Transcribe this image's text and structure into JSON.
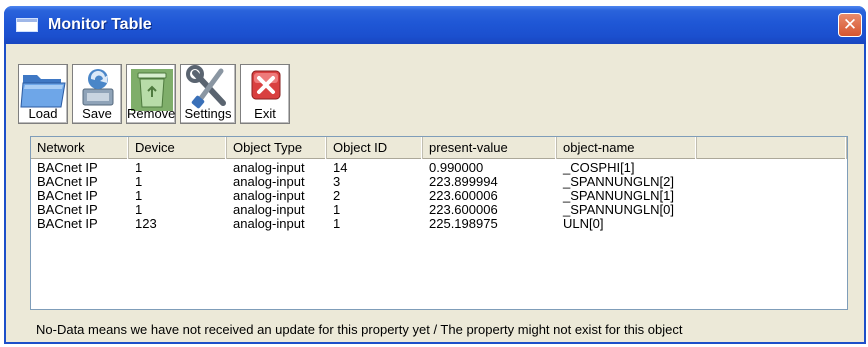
{
  "window": {
    "title": "Monitor Table",
    "close_glyph": "✕"
  },
  "toolbar": {
    "buttons": [
      {
        "label": "Load",
        "icon": "folder-icon"
      },
      {
        "label": "Save",
        "icon": "save-icon"
      },
      {
        "label": "Remove",
        "icon": "trash-icon"
      },
      {
        "label": "Settings",
        "icon": "tools-icon"
      },
      {
        "label": "Exit",
        "icon": "exit-icon"
      }
    ]
  },
  "table": {
    "columns": [
      "Network",
      "Device",
      "Object Type",
      "Object ID",
      "present-value",
      "object-name",
      ""
    ],
    "rows": [
      [
        "BACnet IP",
        "1",
        "analog-input",
        "14",
        "0.990000",
        "_COSPHI[1]"
      ],
      [
        "BACnet IP",
        "1",
        "analog-input",
        "3",
        "223.899994",
        "_SPANNUNGLN[2]"
      ],
      [
        "BACnet IP",
        "1",
        "analog-input",
        "2",
        "223.600006",
        "_SPANNUNGLN[1]"
      ],
      [
        "BACnet IP",
        "1",
        "analog-input",
        "1",
        "223.600006",
        "_SPANNUNGLN[0]"
      ],
      [
        "BACnet IP",
        "123",
        "analog-input",
        "1",
        "225.198975",
        "ULN[0]"
      ]
    ]
  },
  "status": {
    "text": "No-Data means we have not received an update for this property yet  / The property might not exist for this object"
  },
  "colors": {
    "titlebar": "#1f57d6",
    "window_bg": "#ece9d8",
    "close": "#d5552f"
  }
}
